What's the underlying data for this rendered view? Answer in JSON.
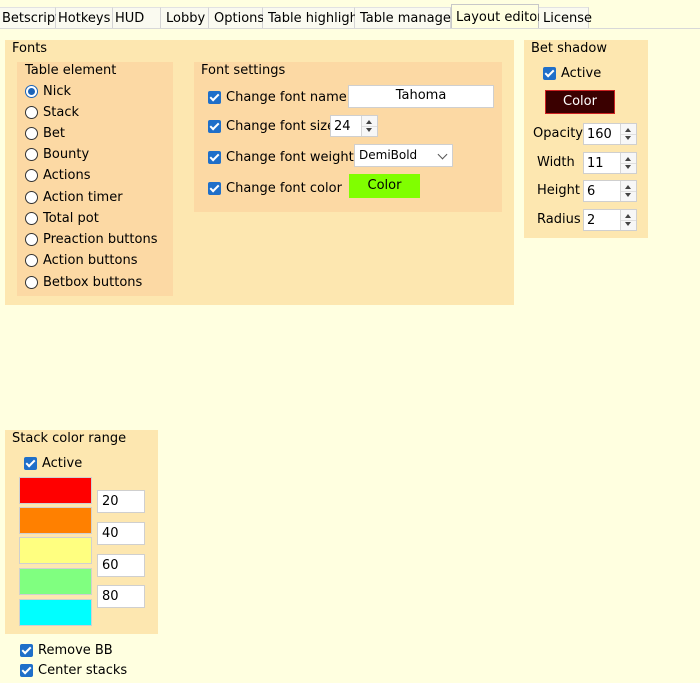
{
  "tabs": [
    "Betscript",
    "Hotkeys",
    "HUD",
    "Lobby",
    "Options",
    "Table highlight",
    "Table manager",
    "Layout editor",
    "License"
  ],
  "active_tab": "Layout editor",
  "fonts": {
    "title": "Fonts",
    "table_element": {
      "title": "Table element",
      "options": [
        "Nick",
        "Stack",
        "Bet",
        "Bounty",
        "Actions",
        "Action timer",
        "Total pot",
        "Preaction buttons",
        "Action buttons",
        "Betbox buttons"
      ],
      "selected": "Nick"
    },
    "settings": {
      "title": "Font settings",
      "change_name_label": "Change font name",
      "font_name": "Tahoma",
      "change_size_label": "Change font size",
      "font_size": "24",
      "change_weight_label": "Change font weight",
      "font_weight": "DemiBold",
      "change_color_label": "Change font color",
      "color_button": "Color",
      "color_button_bg": "#80ff00"
    }
  },
  "bet_shadow": {
    "title": "Bet shadow",
    "active_label": "Active",
    "color_button": "Color",
    "color_button_bg": "#3a0000",
    "opacity_label": "Opacity",
    "opacity": "160",
    "width_label": "Width",
    "width": "11",
    "height_label": "Height",
    "height": "6",
    "radius_label": "Radius",
    "radius": "2"
  },
  "stack_color_range": {
    "title": "Stack color range",
    "active_label": "Active",
    "swatches": [
      "#ff0000",
      "#ff8000",
      "#ffff80",
      "#80ff80",
      "#00ffff"
    ],
    "thresholds": [
      "20",
      "40",
      "60",
      "80"
    ]
  },
  "remove_bb_label": "Remove BB",
  "center_stacks_label": "Center stacks"
}
